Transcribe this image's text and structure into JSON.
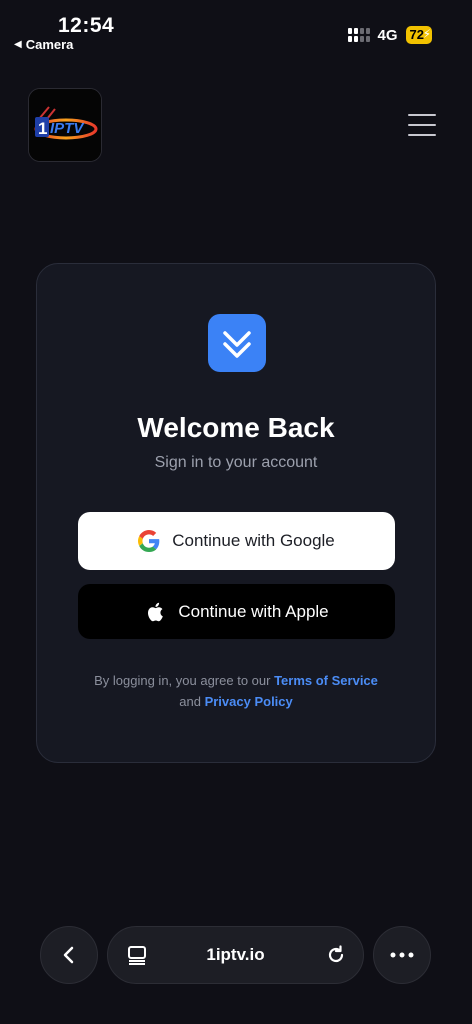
{
  "status_bar": {
    "time": "12:54",
    "back_label": "Camera",
    "network": "4G",
    "battery": "72"
  },
  "header": {
    "logo_icon": "1iptv-logo",
    "logo_text": "1IPTV",
    "menu_icon": "hamburger-menu-icon"
  },
  "login_card": {
    "app_icon": "double-chevron-down-icon",
    "title": "Welcome Back",
    "subtitle": "Sign in to your account",
    "google_button_label": "Continue with Google",
    "apple_button_label": "Continue with Apple",
    "legal_prefix": "By logging in, you agree to our",
    "terms_link": "Terms of Service",
    "legal_and": "and",
    "privacy_link": "Privacy Policy"
  },
  "browser_bar": {
    "url": "1iptv.io",
    "back_icon": "chevron-left-icon",
    "tabs_icon": "page-settings-icon",
    "reload_icon": "reload-icon",
    "more_icon": "more-dots-icon"
  },
  "colors": {
    "background": "#0f0f16",
    "card": "#161822",
    "accent_blue": "#3b82f6",
    "link_blue": "#4b8cf5",
    "battery_yellow": "#f2c200"
  }
}
